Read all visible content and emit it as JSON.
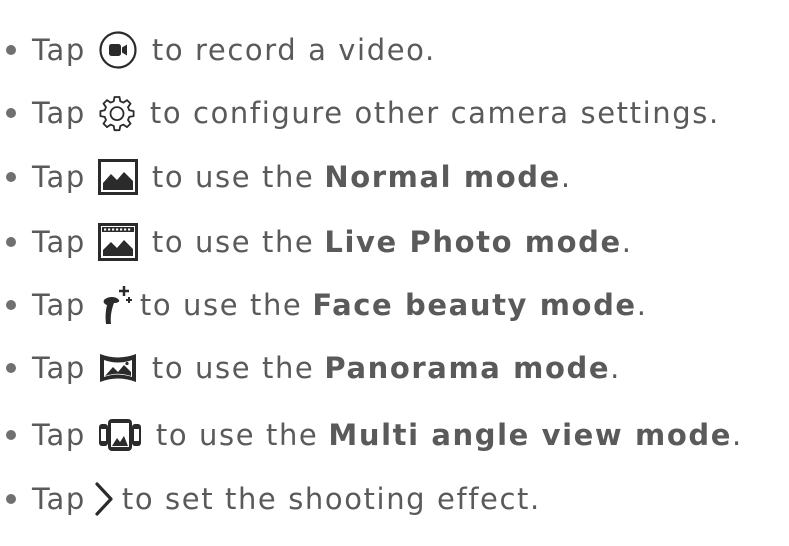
{
  "items": [
    {
      "tap": "Tap",
      "before": "to record a video.",
      "bold": "",
      "after": "",
      "icon": "video-record-icon"
    },
    {
      "tap": "Tap",
      "before": "to configure other camera settings.",
      "bold": "",
      "after": "",
      "icon": "gear-icon"
    },
    {
      "tap": "Tap",
      "before": "to use the",
      "bold": "Normal mode",
      "after": ".",
      "icon": "normal-mode-icon"
    },
    {
      "tap": "Tap",
      "before": "to use the",
      "bold": "Live Photo mode",
      "after": ".",
      "icon": "live-photo-icon"
    },
    {
      "tap": "Tap",
      "before": "to use the",
      "bold": "Face beauty mode",
      "after": ".",
      "icon": "face-beauty-icon"
    },
    {
      "tap": "Tap",
      "before": "to use the",
      "bold": "Panorama mode",
      "after": ".",
      "icon": "panorama-icon"
    },
    {
      "tap": "Tap",
      "before": "to use the",
      "bold": "Multi angle view mode",
      "after": ".",
      "icon": "multi-angle-icon"
    },
    {
      "tap": "Tap",
      "before": "to set the shooting effect.",
      "bold": "",
      "after": "",
      "icon": "chevron-right-icon"
    }
  ],
  "colors": {
    "text": "#5a5a5a",
    "icon": "#2b2b2b"
  }
}
